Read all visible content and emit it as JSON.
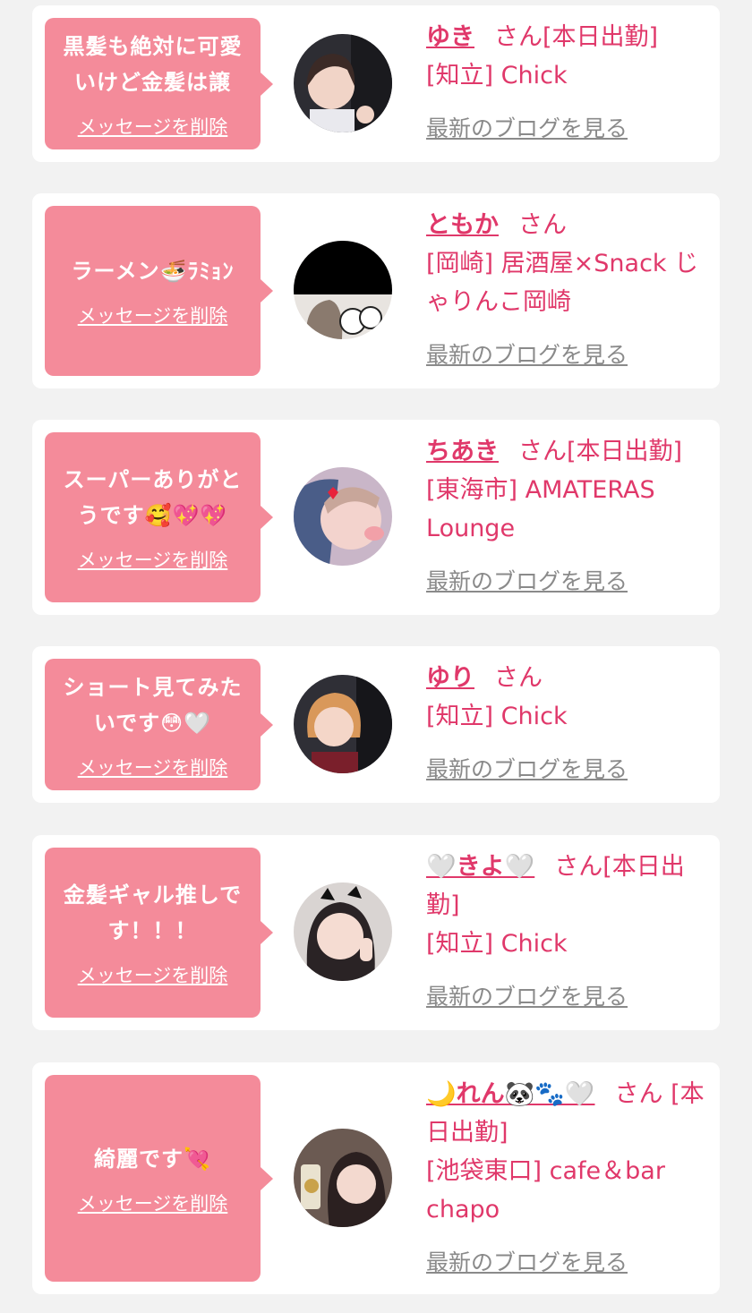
{
  "accent_color": "#e0386a",
  "bubble_color": "#f48b9a",
  "entries": [
    {
      "message": "黒髪も絶対に可愛いけど金髪は譲",
      "delete_label": "メッセージを削除",
      "name": "ゆき",
      "honorific": "さん",
      "status": "[本日出勤]",
      "shop": "[知立] Chick",
      "blog_label": "最新のブログを見る"
    },
    {
      "message": "ラーメン🍜ﾗﾐｮﾝ",
      "delete_label": "メッセージを削除",
      "name": "ともか",
      "honorific": "さん",
      "status": "",
      "shop": "[岡崎] 居酒屋×Snack じゃりんこ岡崎",
      "blog_label": "最新のブログを見る"
    },
    {
      "message": "スーパーありがとうです🥰💖💖",
      "delete_label": "メッセージを削除",
      "name": "ちあき",
      "honorific": "さん",
      "status": "[本日出勤]",
      "shop": "[東海市] AMATERAS Lounge",
      "blog_label": "最新のブログを見る"
    },
    {
      "message": "ショート見てみたいです😳🤍",
      "delete_label": "メッセージを削除",
      "name": "ゆり",
      "honorific": "さん",
      "status": "",
      "shop": "[知立] Chick",
      "blog_label": "最新のブログを見る"
    },
    {
      "message": "金髪ギャル推しです！！！",
      "delete_label": "メッセージを削除",
      "name": "🤍きよ🤍",
      "honorific": "さん",
      "status": "[本日出勤]",
      "shop": "[知立] Chick",
      "blog_label": "最新のブログを見る"
    },
    {
      "message": "綺麗です💘",
      "delete_label": "メッセージを削除",
      "name": "🌙れん🐼🐾🤍",
      "honorific": "さん",
      "status": "[本日出勤]",
      "shop": "[池袋東口] cafe＆bar chapo",
      "blog_label": "最新のブログを見る"
    }
  ]
}
